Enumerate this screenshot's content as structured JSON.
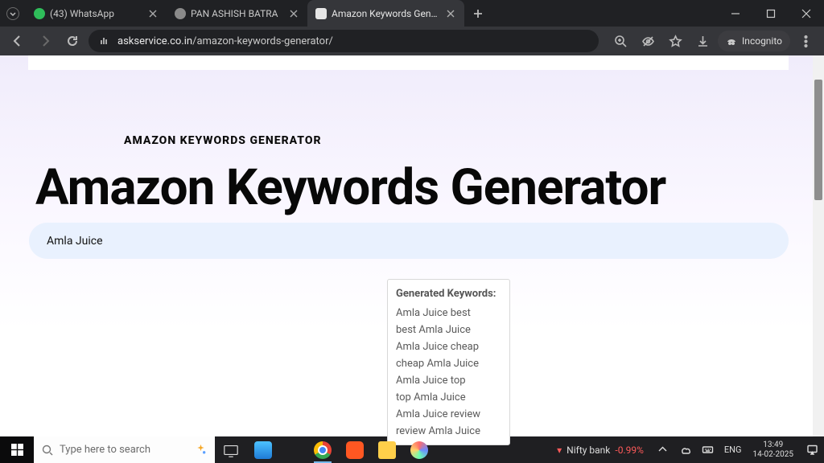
{
  "browser": {
    "tabs": [
      {
        "label": "(43) WhatsApp",
        "favico": "#2fbd5a"
      },
      {
        "label": "PAN ASHISH BATRA",
        "favico": "#8a8a8a"
      },
      {
        "label": "Amazon Keywords Generator",
        "favico": "#3a4ea8",
        "active": true
      }
    ],
    "url_host": "askservice.co.in",
    "url_path": "/amazon-keywords-generator/",
    "incognito_label": "Incognito"
  },
  "page": {
    "tagline": "AMAZON KEYWORDS GENERATOR",
    "h1": "Amazon Keywords Generator",
    "search_value": "Amla Juice",
    "results_header": "Generated Keywords:",
    "keywords": [
      "Amla Juice best",
      "best Amla Juice",
      "Amla Juice cheap",
      "cheap Amla Juice",
      "Amla Juice top",
      "top Amla Juice",
      "Amla Juice review",
      "review Amla Juice"
    ]
  },
  "taskbar": {
    "search_placeholder": "Type here to search",
    "ticker_label": "Nifty bank",
    "ticker_delta": "-0.99%",
    "lang": "ENG",
    "time": "13:49",
    "date": "14-02-2025"
  }
}
